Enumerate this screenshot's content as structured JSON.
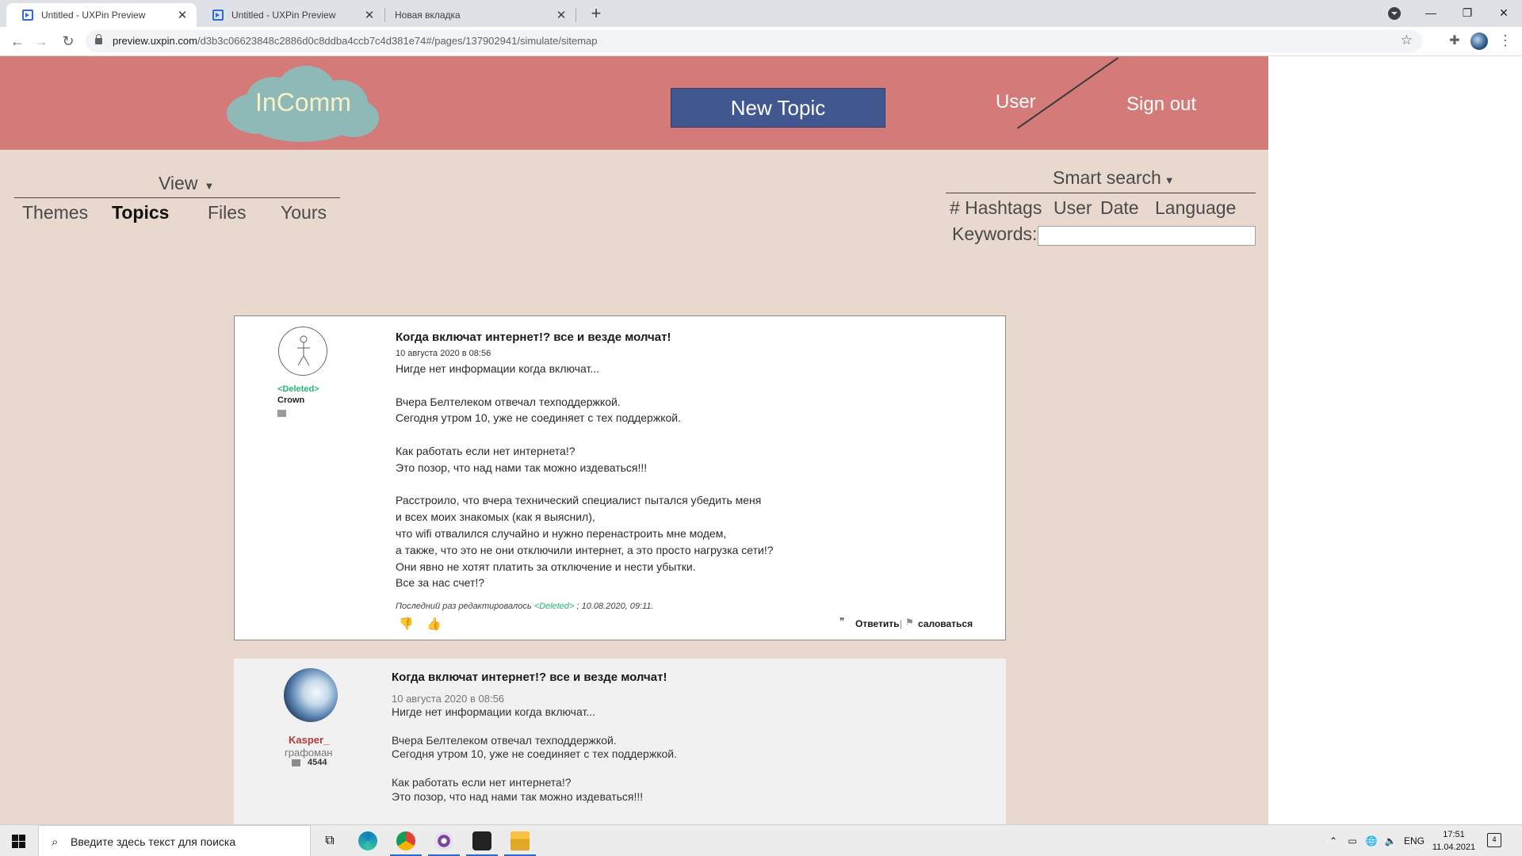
{
  "browser": {
    "tabs": [
      {
        "title": "Untitled - UXPin Preview",
        "active": true
      },
      {
        "title": "Untitled - UXPin Preview",
        "active": false
      },
      {
        "title": "Новая вкладка",
        "active": false
      }
    ],
    "url_host": "preview.uxpin.com",
    "url_path": "/d3b3c06623848c2886d0c8ddba4ccb7c4d381e74#/pages/137902941/simulate/sitemap"
  },
  "header": {
    "logo": "InComm",
    "new_topic": "New Topic",
    "user": "User",
    "sign_out": "Sign out"
  },
  "view_menu": {
    "label": "View",
    "items": [
      "Themes",
      "Topics",
      "Files",
      "Yours"
    ],
    "active": "Topics"
  },
  "smart_search": {
    "label": "Smart search",
    "filters": [
      "# Hashtags",
      "User",
      "Date",
      "Language"
    ],
    "keywords_label": "Keywords:",
    "keywords_value": ""
  },
  "posts": [
    {
      "author": "<Deleted>",
      "rank": "Crown",
      "title": "Когда включат интернет!? все и везде молчат!",
      "date": "10 августа 2020 в 08:56",
      "body": [
        "Нигде нет информации когда включат...",
        "",
        "Вчера Белтелеком отвечал техподдержкой.",
        "Сегодня утром 10, уже не соединяет с тех поддержкой.",
        "",
        "Как работать если нет интернета!?",
        "Это позор, что над нами так можно издеваться!!!",
        "",
        "Расстроило, что вчера технический специалист пытался убедить меня",
        "и всех моих знакомых (как я выяснил),",
        "что wifi отвалился случайно и нужно перенастроить мне модем,",
        "а также, что это не они отключили интернет, а это просто нагрузка сети!?",
        "Они явно не хотят платить за отключение и нести убытки.",
        "Все за нас счет!?"
      ],
      "edited_prefix": "Последний раз редактировалось",
      "edited_user": "<Deleted>",
      "edited_suffix": "; 10.08.2020, 09:11.",
      "reply": "Ответить",
      "complain": "саловаться"
    },
    {
      "author": "Kasper_",
      "rank": "графоман",
      "message_count": "4544",
      "title": "Когда включат интернет!? все и везде молчат!",
      "date": "10 августа 2020 в 08:56",
      "body": [
        "Нигде нет информации когда включат...",
        "",
        "Вчера Белтелеком отвечал техподдержкой.",
        "Сегодня утром 10, уже не соединяет с тех поддержкой.",
        "",
        "Как работать если нет интернета!?",
        "Это позор, что над нами так можно издеваться!!!"
      ]
    }
  ],
  "taskbar": {
    "search_placeholder": "Введите здесь текст для поиска",
    "lang": "ENG",
    "time": "17:51",
    "date": "11.04.2021",
    "notifications": "4"
  }
}
